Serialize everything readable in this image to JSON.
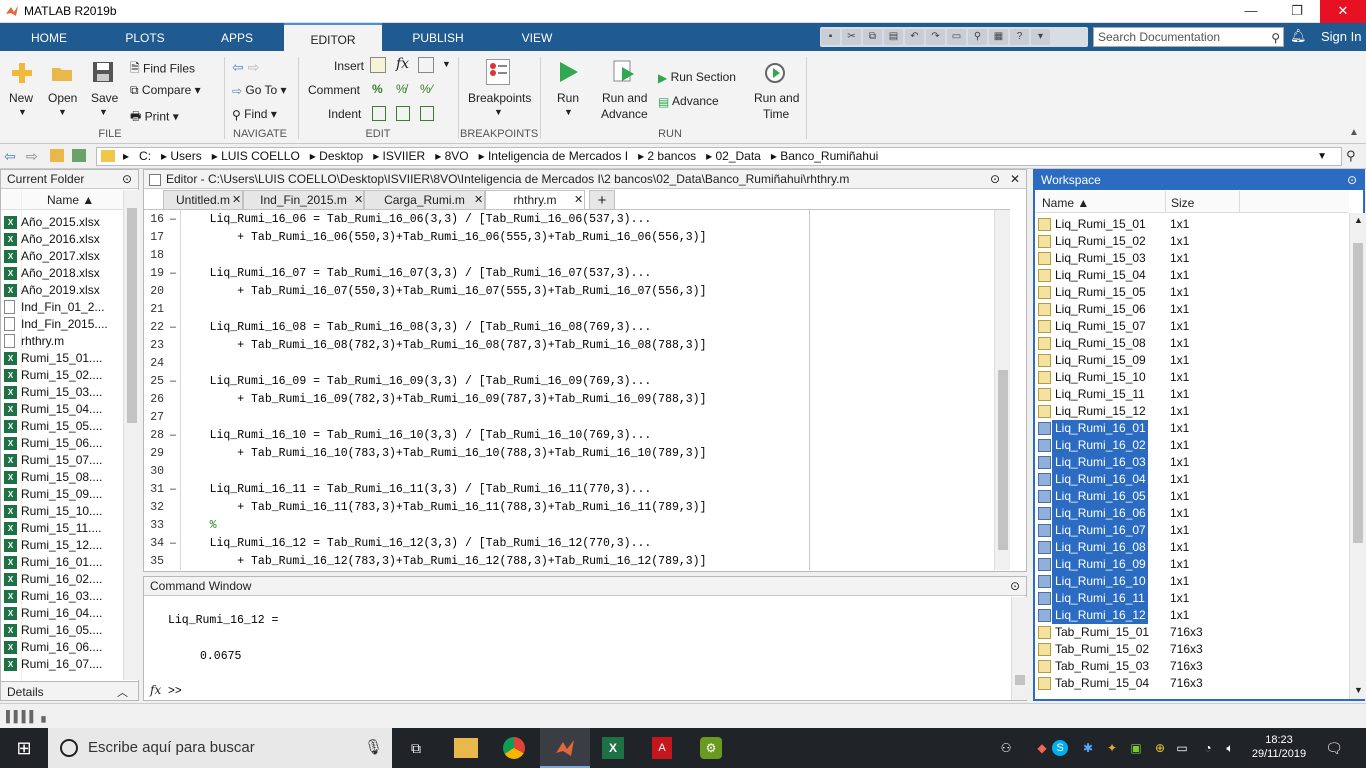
{
  "window": {
    "title": "MATLAB R2019b"
  },
  "ribbon_tabs": [
    {
      "label": "HOME"
    },
    {
      "label": "PLOTS"
    },
    {
      "label": "APPS"
    },
    {
      "label": "EDITOR"
    },
    {
      "label": "PUBLISH"
    },
    {
      "label": "VIEW"
    }
  ],
  "search": {
    "placeholder": "Search Documentation"
  },
  "signin": "Sign In",
  "toolstrip": {
    "file": {
      "section": "FILE",
      "new": "New",
      "open": "Open",
      "save": "Save",
      "find_files": "Find Files",
      "compare": "Compare",
      "print": "Print"
    },
    "navigate": {
      "section": "NAVIGATE",
      "go_to": "Go To",
      "find": "Find"
    },
    "edit": {
      "section": "EDIT",
      "insert": "Insert",
      "comment": "Comment",
      "indent": "Indent",
      "fx": "fx"
    },
    "breakpoints": {
      "section": "BREAKPOINTS",
      "breakpoints": "Breakpoints"
    },
    "run": {
      "section": "RUN",
      "run": "Run",
      "run_and": "Run and",
      "advance": "Advance",
      "run_section": "Run Section",
      "advance_btn": "Advance",
      "run_and2": "Run and",
      "time": "Time"
    }
  },
  "address": [
    "C:",
    "Users",
    "LUIS COELLO",
    "Desktop",
    "ISVIIER",
    "8VO",
    "Inteligencia de Mercados I",
    "2 bancos",
    "02_Data",
    "Banco_Rumiñahui"
  ],
  "current_folder": {
    "title": "Current Folder",
    "column": "Name ▲",
    "items": [
      {
        "name": "Año_2015.xlsx",
        "type": "xls"
      },
      {
        "name": "Año_2016.xlsx",
        "type": "xls"
      },
      {
        "name": "Año_2017.xlsx",
        "type": "xls"
      },
      {
        "name": "Año_2018.xlsx",
        "type": "xls"
      },
      {
        "name": "Año_2019.xlsx",
        "type": "xls"
      },
      {
        "name": "Ind_Fin_01_2...",
        "type": "m"
      },
      {
        "name": "Ind_Fin_2015....",
        "type": "m"
      },
      {
        "name": "rhthry.m",
        "type": "m"
      },
      {
        "name": "Rumi_15_01....",
        "type": "xls"
      },
      {
        "name": "Rumi_15_02....",
        "type": "xls"
      },
      {
        "name": "Rumi_15_03....",
        "type": "xls"
      },
      {
        "name": "Rumi_15_04....",
        "type": "xls"
      },
      {
        "name": "Rumi_15_05....",
        "type": "xls"
      },
      {
        "name": "Rumi_15_06....",
        "type": "xls"
      },
      {
        "name": "Rumi_15_07....",
        "type": "xls"
      },
      {
        "name": "Rumi_15_08....",
        "type": "xls"
      },
      {
        "name": "Rumi_15_09....",
        "type": "xls"
      },
      {
        "name": "Rumi_15_10....",
        "type": "xls"
      },
      {
        "name": "Rumi_15_11....",
        "type": "xls"
      },
      {
        "name": "Rumi_15_12....",
        "type": "xls"
      },
      {
        "name": "Rumi_16_01....",
        "type": "xls"
      },
      {
        "name": "Rumi_16_02....",
        "type": "xls"
      },
      {
        "name": "Rumi_16_03....",
        "type": "xls"
      },
      {
        "name": "Rumi_16_04....",
        "type": "xls"
      },
      {
        "name": "Rumi_16_05....",
        "type": "xls"
      },
      {
        "name": "Rumi_16_06....",
        "type": "xls"
      },
      {
        "name": "Rumi_16_07....",
        "type": "xls"
      }
    ],
    "details": "Details"
  },
  "editor": {
    "title": "Editor - C:\\Users\\LUIS COELLO\\Desktop\\ISVIIER\\8VO\\Inteligencia de Mercados I\\2 bancos\\02_Data\\Banco_Rumiñahui\\rhthry.m",
    "tabs": [
      {
        "label": "Untitled.m"
      },
      {
        "label": "Ind_Fin_2015.m"
      },
      {
        "label": "Carga_Rumi.m"
      },
      {
        "label": "rhthry.m"
      }
    ],
    "add_tab": "+",
    "lines": [
      {
        "n": "16",
        "dash": "–",
        "text": "    Liq_Rumi_16_06 = Tab_Rumi_16_06(3,3) / [Tab_Rumi_16_06(537,3)..."
      },
      {
        "n": "17",
        "dash": "",
        "text": "        + Tab_Rumi_16_06(550,3)+Tab_Rumi_16_06(555,3)+Tab_Rumi_16_06(556,3)]"
      },
      {
        "n": "18",
        "dash": "",
        "text": ""
      },
      {
        "n": "19",
        "dash": "–",
        "text": "    Liq_Rumi_16_07 = Tab_Rumi_16_07(3,3) / [Tab_Rumi_16_07(537,3)..."
      },
      {
        "n": "20",
        "dash": "",
        "text": "        + Tab_Rumi_16_07(550,3)+Tab_Rumi_16_07(555,3)+Tab_Rumi_16_07(556,3)]"
      },
      {
        "n": "21",
        "dash": "",
        "text": ""
      },
      {
        "n": "22",
        "dash": "–",
        "text": "    Liq_Rumi_16_08 = Tab_Rumi_16_08(3,3) / [Tab_Rumi_16_08(769,3)..."
      },
      {
        "n": "23",
        "dash": "",
        "text": "        + Tab_Rumi_16_08(782,3)+Tab_Rumi_16_08(787,3)+Tab_Rumi_16_08(788,3)]"
      },
      {
        "n": "24",
        "dash": "",
        "text": ""
      },
      {
        "n": "25",
        "dash": "–",
        "text": "    Liq_Rumi_16_09 = Tab_Rumi_16_09(3,3) / [Tab_Rumi_16_09(769,3)..."
      },
      {
        "n": "26",
        "dash": "",
        "text": "        + Tab_Rumi_16_09(782,3)+Tab_Rumi_16_09(787,3)+Tab_Rumi_16_09(788,3)]"
      },
      {
        "n": "27",
        "dash": "",
        "text": ""
      },
      {
        "n": "28",
        "dash": "–",
        "text": "    Liq_Rumi_16_10 = Tab_Rumi_16_10(3,3) / [Tab_Rumi_16_10(769,3)..."
      },
      {
        "n": "29",
        "dash": "",
        "text": "        + Tab_Rumi_16_10(783,3)+Tab_Rumi_16_10(788,3)+Tab_Rumi_16_10(789,3)]"
      },
      {
        "n": "30",
        "dash": "",
        "text": ""
      },
      {
        "n": "31",
        "dash": "–",
        "text": "    Liq_Rumi_16_11 = Tab_Rumi_16_11(3,3) / [Tab_Rumi_16_11(770,3)..."
      },
      {
        "n": "32",
        "dash": "",
        "text": "        + Tab_Rumi_16_11(783,3)+Tab_Rumi_16_11(788,3)+Tab_Rumi_16_11(789,3)]"
      },
      {
        "n": "33",
        "dash": "",
        "text": "    %"
      },
      {
        "n": "34",
        "dash": "–",
        "text": "    Liq_Rumi_16_12 = Tab_Rumi_16_12(3,3) / [Tab_Rumi_16_12(770,3)..."
      },
      {
        "n": "35",
        "dash": "",
        "text": "        + Tab_Rumi_16_12(783,3)+Tab_Rumi_16_12(788,3)+Tab_Rumi_16_12(789,3)]"
      }
    ]
  },
  "command_window": {
    "title": "Command Window",
    "output_var": "Liq_Rumi_16_12 =",
    "output_val": "0.0675",
    "prompt": ">>",
    "fx": "fx"
  },
  "workspace": {
    "title": "Workspace",
    "col_name": "Name ▲",
    "col_size": "Size",
    "rows": [
      {
        "name": "Liq_Rumi_15_01",
        "size": "1x1",
        "selected": false
      },
      {
        "name": "Liq_Rumi_15_02",
        "size": "1x1",
        "selected": false
      },
      {
        "name": "Liq_Rumi_15_03",
        "size": "1x1",
        "selected": false
      },
      {
        "name": "Liq_Rumi_15_04",
        "size": "1x1",
        "selected": false
      },
      {
        "name": "Liq_Rumi_15_05",
        "size": "1x1",
        "selected": false
      },
      {
        "name": "Liq_Rumi_15_06",
        "size": "1x1",
        "selected": false
      },
      {
        "name": "Liq_Rumi_15_07",
        "size": "1x1",
        "selected": false
      },
      {
        "name": "Liq_Rumi_15_08",
        "size": "1x1",
        "selected": false
      },
      {
        "name": "Liq_Rumi_15_09",
        "size": "1x1",
        "selected": false
      },
      {
        "name": "Liq_Rumi_15_10",
        "size": "1x1",
        "selected": false
      },
      {
        "name": "Liq_Rumi_15_11",
        "size": "1x1",
        "selected": false
      },
      {
        "name": "Liq_Rumi_15_12",
        "size": "1x1",
        "selected": false
      },
      {
        "name": "Liq_Rumi_16_01",
        "size": "1x1",
        "selected": true
      },
      {
        "name": "Liq_Rumi_16_02",
        "size": "1x1",
        "selected": true
      },
      {
        "name": "Liq_Rumi_16_03",
        "size": "1x1",
        "selected": true
      },
      {
        "name": "Liq_Rumi_16_04",
        "size": "1x1",
        "selected": true
      },
      {
        "name": "Liq_Rumi_16_05",
        "size": "1x1",
        "selected": true
      },
      {
        "name": "Liq_Rumi_16_06",
        "size": "1x1",
        "selected": true
      },
      {
        "name": "Liq_Rumi_16_07",
        "size": "1x1",
        "selected": true
      },
      {
        "name": "Liq_Rumi_16_08",
        "size": "1x1",
        "selected": true
      },
      {
        "name": "Liq_Rumi_16_09",
        "size": "1x1",
        "selected": true
      },
      {
        "name": "Liq_Rumi_16_10",
        "size": "1x1",
        "selected": true
      },
      {
        "name": "Liq_Rumi_16_11",
        "size": "1x1",
        "selected": true
      },
      {
        "name": "Liq_Rumi_16_12",
        "size": "1x1",
        "selected": true
      },
      {
        "name": "Tab_Rumi_15_01",
        "size": "716x3",
        "selected": false
      },
      {
        "name": "Tab_Rumi_15_02",
        "size": "716x3",
        "selected": false
      },
      {
        "name": "Tab_Rumi_15_03",
        "size": "716x3",
        "selected": false
      },
      {
        "name": "Tab_Rumi_15_04",
        "size": "716x3",
        "selected": false
      }
    ]
  },
  "taskbar": {
    "search_placeholder": "Escribe aquí para buscar",
    "time": "18:23",
    "date": "29/11/2019"
  },
  "colors": {
    "accent": "#1f5a91",
    "selection": "#2b6cc2",
    "taskbar": "#202327"
  }
}
